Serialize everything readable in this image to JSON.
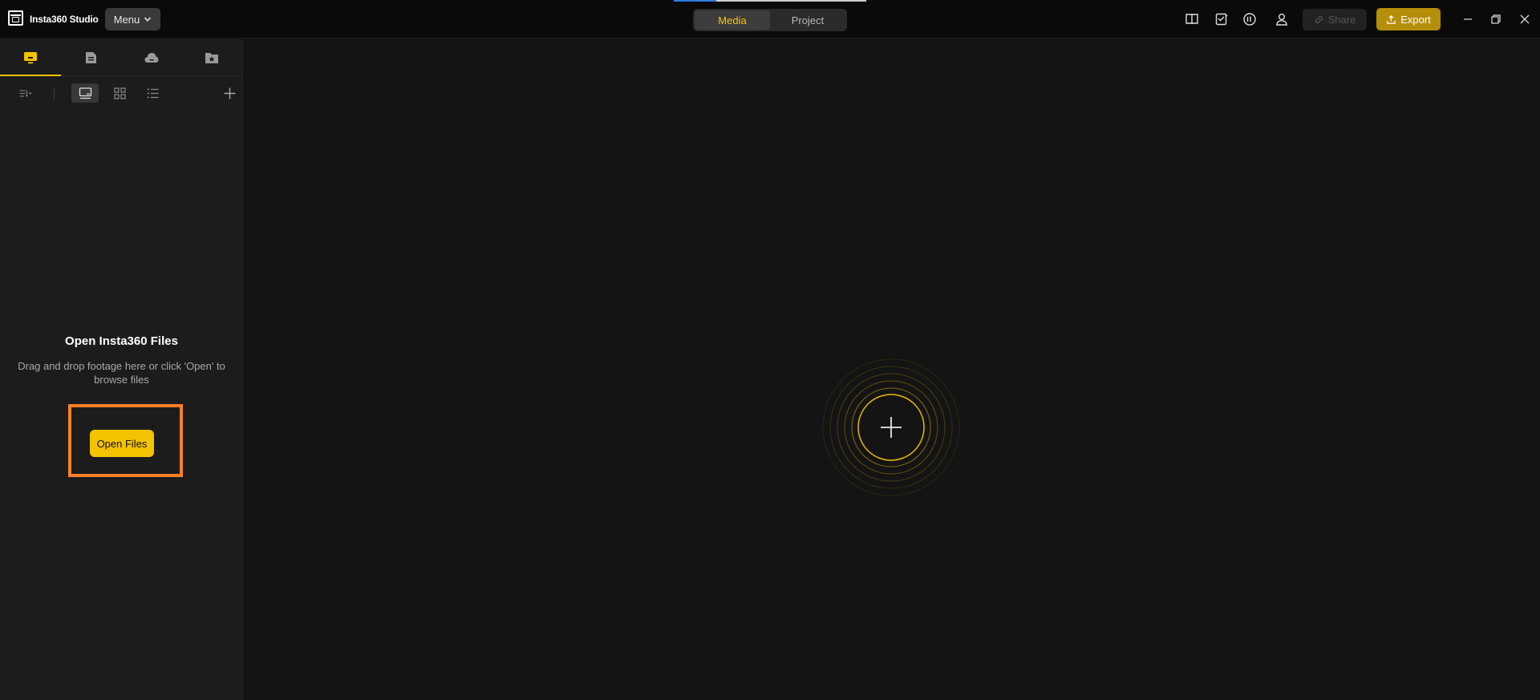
{
  "titlebar": {
    "app_title": "Insta360 Studio",
    "menu_label": "Menu",
    "progress_fraction": 0.22,
    "tabs": [
      {
        "label": "Media",
        "active": true
      },
      {
        "label": "Project",
        "active": false
      }
    ],
    "icons": [
      "book-icon",
      "edit-list-icon",
      "counter-icon",
      "user-icon"
    ],
    "share_label": "Share",
    "export_label": "Export",
    "window_controls": [
      "minimize-icon",
      "restore-icon",
      "close-icon"
    ]
  },
  "sidebar": {
    "tabs": [
      {
        "icon": "local-media-icon",
        "active": true
      },
      {
        "icon": "sd-card-icon",
        "active": false
      },
      {
        "icon": "cloud-icon",
        "active": false
      },
      {
        "icon": "favorites-folder-icon",
        "active": false
      }
    ],
    "toolbar": [
      "sort-icon",
      "large-thumbnail-view-icon",
      "grid-view-icon",
      "list-view-icon",
      "add-icon"
    ],
    "empty_title": "Open Insta360 Files",
    "empty_desc": "Drag and drop footage here or click 'Open' to browse files",
    "open_button": "Open Files"
  },
  "colors": {
    "accent": "#f4c300",
    "export_bg": "#b58f0a",
    "highlight": "#ff7f27",
    "background": "#141414",
    "sidebar_bg": "#1c1c1c"
  }
}
